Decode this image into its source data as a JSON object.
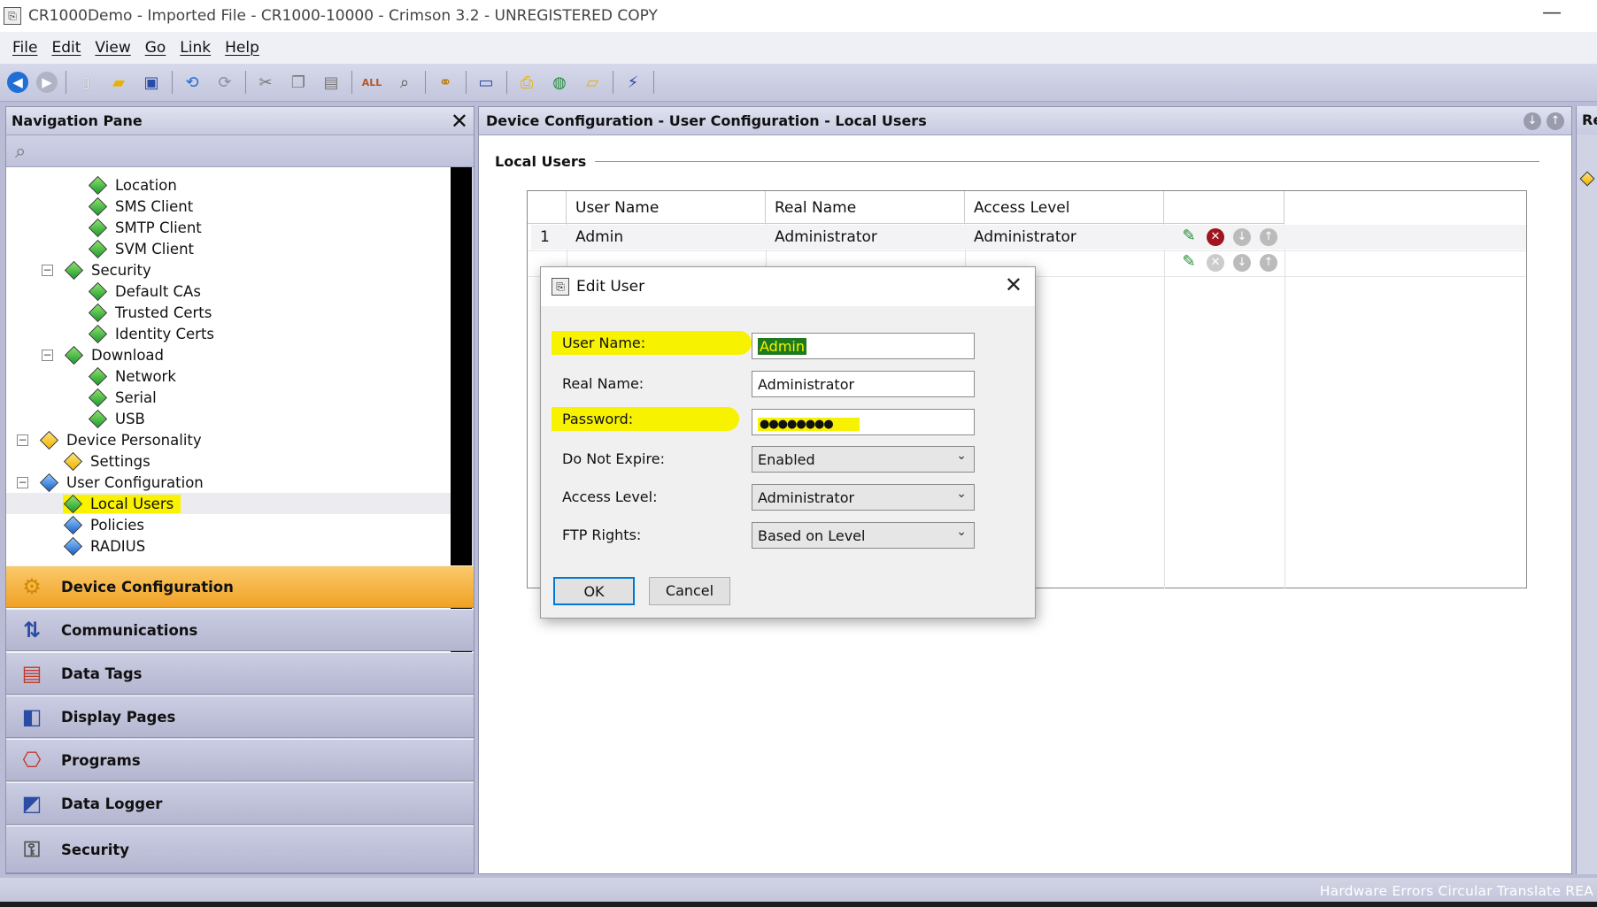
{
  "window": {
    "title": "CR1000Demo - Imported File - CR1000-10000 - Crimson 3.2 - UNREGISTERED COPY",
    "minimize": "—"
  },
  "menu": [
    "File",
    "Edit",
    "View",
    "Go",
    "Link",
    "Help"
  ],
  "nav": {
    "title": "Navigation Pane",
    "close": "✕",
    "tree": [
      {
        "label": "Location",
        "level": 2,
        "icon": "green"
      },
      {
        "label": "SMS Client",
        "level": 2,
        "icon": "green"
      },
      {
        "label": "SMTP Client",
        "level": 2,
        "icon": "green"
      },
      {
        "label": "SVM Client",
        "level": 2,
        "icon": "green"
      },
      {
        "label": "Security",
        "level": 1,
        "icon": "green",
        "expander": "⊟"
      },
      {
        "label": "Default CAs",
        "level": 2,
        "icon": "green"
      },
      {
        "label": "Trusted Certs",
        "level": 2,
        "icon": "green"
      },
      {
        "label": "Identity Certs",
        "level": 2,
        "icon": "green"
      },
      {
        "label": "Download",
        "level": 1,
        "icon": "green",
        "expander": "⊟"
      },
      {
        "label": "Network",
        "level": 2,
        "icon": "green"
      },
      {
        "label": "Serial",
        "level": 2,
        "icon": "green"
      },
      {
        "label": "USB",
        "level": 2,
        "icon": "green"
      },
      {
        "label": "Device Personality",
        "level": 0,
        "icon": "yellow",
        "expander": "⊟"
      },
      {
        "label": "Settings",
        "level": 1,
        "icon": "yellow"
      },
      {
        "label": "User Configuration",
        "level": 0,
        "icon": "blue",
        "expander": "⊟"
      },
      {
        "label": "Local Users",
        "level": 1,
        "icon": "green",
        "selected": true
      },
      {
        "label": "Policies",
        "level": 1,
        "icon": "blue"
      },
      {
        "label": "RADIUS",
        "level": 1,
        "icon": "blue"
      }
    ],
    "categories": [
      {
        "label": "Device Configuration",
        "icon": "gears-icon",
        "active": true
      },
      {
        "label": "Communications",
        "icon": "communications-icon"
      },
      {
        "label": "Data Tags",
        "icon": "data-tags-icon"
      },
      {
        "label": "Display Pages",
        "icon": "display-pages-icon"
      },
      {
        "label": "Programs",
        "icon": "programs-icon"
      },
      {
        "label": "Data Logger",
        "icon": "data-logger-icon"
      },
      {
        "label": "Security",
        "icon": "security-icon"
      }
    ]
  },
  "main": {
    "title": "Device Configuration - User Configuration - Local Users",
    "section": "Local Users",
    "columns": [
      "User Name",
      "Real Name",
      "Access Level"
    ],
    "rows": [
      {
        "index": "1",
        "user": "Admin",
        "real": "Administrator",
        "access": "Administrator"
      }
    ]
  },
  "right_pane": {
    "title": "Re"
  },
  "status_bar": "Hardware  Errors  Circular  Translate  REA",
  "dialog": {
    "title": "Edit User",
    "fields": {
      "user_name_label": "User Name:",
      "user_name_value": "Admin",
      "real_name_label": "Real Name:",
      "real_name_value": "Administrator",
      "password_label": "Password:",
      "password_value": "●●●●●●●●",
      "expire_label": "Do Not Expire:",
      "expire_value": "Enabled",
      "access_label": "Access Level:",
      "access_value": "Administrator",
      "ftp_label": "FTP Rights:",
      "ftp_value": "Based on Level"
    },
    "ok": "OK",
    "cancel": "Cancel"
  },
  "colors": {
    "highlight": "#f6f200",
    "active_category": "#f0a226",
    "selection_box": "#1e7a1e"
  }
}
